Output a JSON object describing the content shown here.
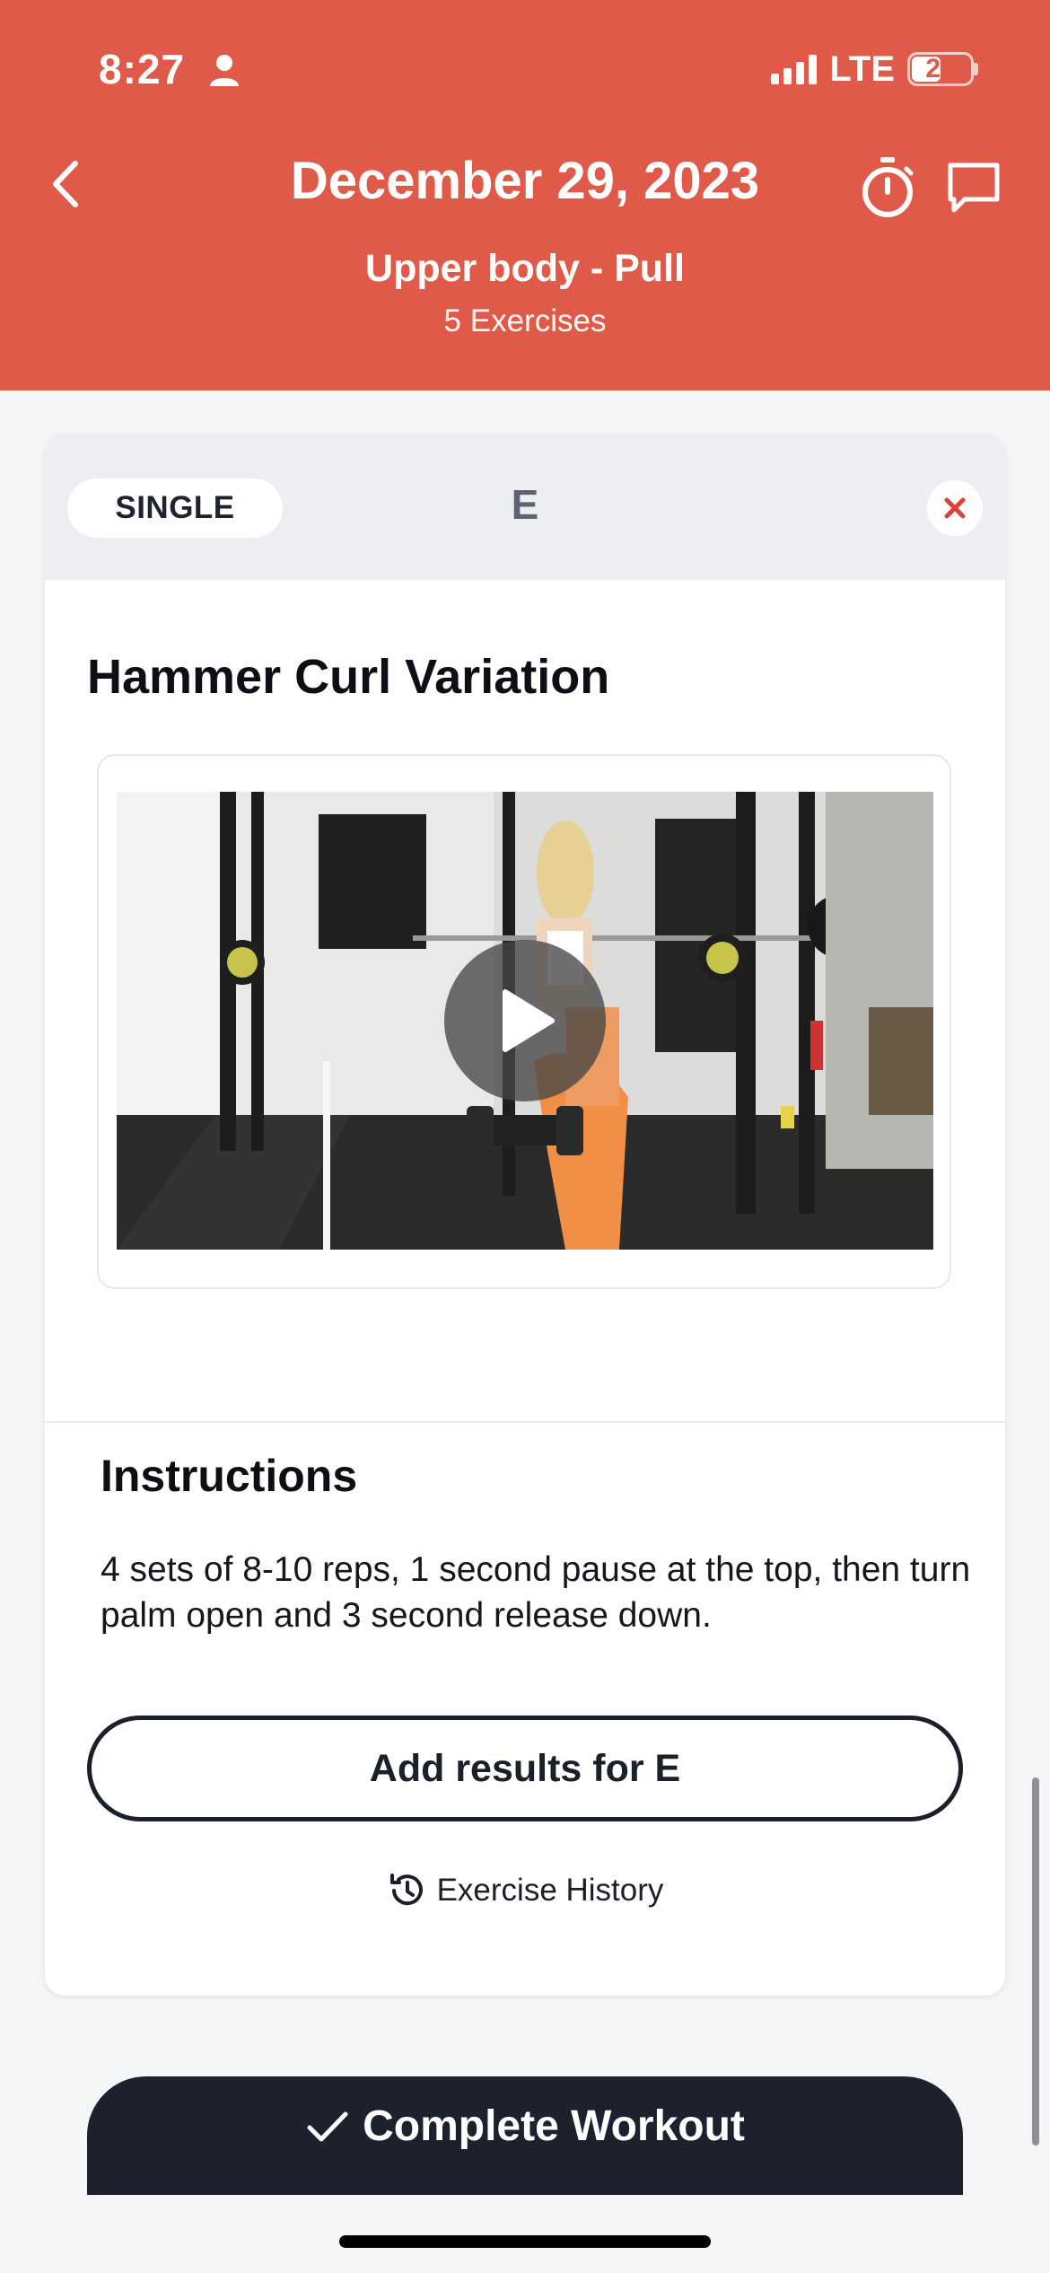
{
  "status_bar": {
    "time": "8:27",
    "network": "LTE",
    "battery": "27"
  },
  "header": {
    "date_title": "December 29, 2023",
    "workout_name": "Upper body - Pull",
    "exercise_count": "5 Exercises",
    "background_color": "#e05a4a"
  },
  "exercise_card": {
    "type_pill": "SINGLE",
    "letter": "E",
    "exercise_name": "Hammer Curl Variation",
    "instructions_heading": "Instructions",
    "instructions_text": "4 sets of 8-10 reps, 1 second pause at the top, then turn palm open and 3 second release down.",
    "add_results_label": "Add results for E",
    "history_label": "Exercise History"
  },
  "complete_button": {
    "label": "Complete Workout"
  },
  "icons": [
    "person-icon",
    "signal-icon",
    "battery-icon",
    "back-chevron-icon",
    "stopwatch-icon",
    "chat-icon",
    "close-icon",
    "play-icon",
    "history-icon",
    "checkmark-icon"
  ]
}
